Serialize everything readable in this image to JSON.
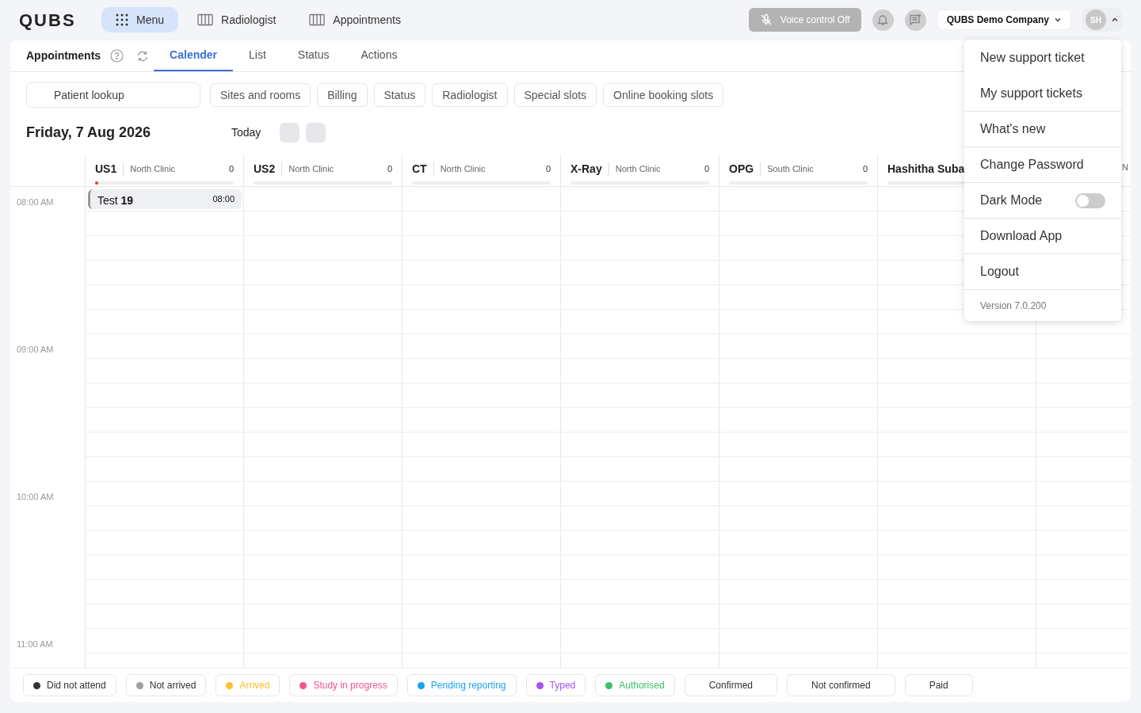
{
  "brand": "QUBS",
  "top_nav": [
    {
      "label": "Menu",
      "kind": "grid",
      "selected": true
    },
    {
      "label": "Radiologist",
      "kind": "columns",
      "selected": false
    },
    {
      "label": "Appointments",
      "kind": "columns",
      "selected": false
    }
  ],
  "voice_control": {
    "label": "Voice control Off",
    "on": false
  },
  "company": "QUBS Demo Company",
  "user": {
    "initials": "SH",
    "menu_open": true
  },
  "page_title": "Appointments",
  "tabs": [
    {
      "label": "Calender",
      "selected": true
    },
    {
      "label": "List",
      "selected": false
    },
    {
      "label": "Status",
      "selected": false
    },
    {
      "label": "Actions",
      "selected": false
    }
  ],
  "patient_lookup": {
    "label": "Patient lookup"
  },
  "filters": [
    "Sites and rooms",
    "Billing",
    "Status",
    "Radiologist",
    "Special slots",
    "Online booking slots"
  ],
  "date": "Friday, 7 Aug 2026",
  "today": "Today",
  "columns": [
    {
      "name": "US1",
      "site": "North Clinic",
      "count": "0",
      "active": true
    },
    {
      "name": "US2",
      "site": "North Clinic",
      "count": "0",
      "active": false
    },
    {
      "name": "CT",
      "site": "North Clinic",
      "count": "0",
      "active": false
    },
    {
      "name": "X-Ray",
      "site": "North Clinic",
      "count": "0",
      "active": false
    },
    {
      "name": "OPG",
      "site": "South Clinic",
      "count": "0",
      "active": false
    },
    {
      "name": "Hashitha Suba",
      "active": false
    },
    {
      "site": "N",
      "active": false
    }
  ],
  "times": [
    "08:00 AM",
    "09:00 AM",
    "10:00 AM",
    "11:00 AM"
  ],
  "appointment": {
    "title": "Test **19**",
    "time": "08:00"
  },
  "legend": [
    {
      "label": "Did not attend",
      "color": "#333333",
      "tinted": false
    },
    {
      "label": "Not arrived",
      "color": "#9e9e9e",
      "tinted": false
    },
    {
      "label": "Arrived",
      "color": "#fbc02d",
      "tinted": true
    },
    {
      "label": "Study in progress",
      "color": "#f0568a",
      "tinted": true
    },
    {
      "label": "Pending reporting",
      "color": "#1ea1f2",
      "tinted": true
    },
    {
      "label": "Typed",
      "color": "#a455f0",
      "tinted": true
    },
    {
      "label": "Authorised",
      "color": "#3cbf6a",
      "tinted": true
    },
    {
      "label": "Confirmed"
    },
    {
      "label": "Not confirmed"
    },
    {
      "label": "Paid"
    }
  ],
  "user_menu": [
    {
      "label": "New support ticket",
      "kind": "item",
      "divider": false
    },
    {
      "label": "My support tickets",
      "kind": "item",
      "divider": false
    },
    {
      "label": "What's new",
      "kind": "item",
      "divider": true
    },
    {
      "label": "Change Password",
      "kind": "item",
      "divider": true
    },
    {
      "label": "Dark Mode",
      "kind": "toggle",
      "on": false,
      "divider": true
    },
    {
      "label": "Download App",
      "kind": "item",
      "divider": true
    },
    {
      "label": "Logout",
      "kind": "item",
      "divider": true
    },
    {
      "label": "Version 7.0.200",
      "kind": "version",
      "divider": true
    }
  ]
}
